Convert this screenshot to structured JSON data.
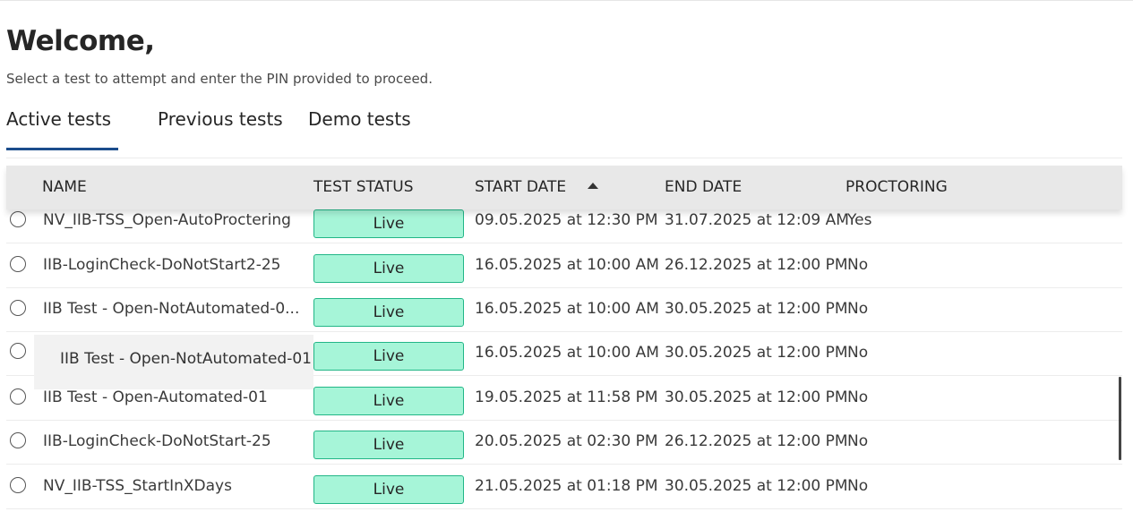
{
  "header": {
    "title": "Welcome,",
    "subtitle": "Select a test to attempt and enter the PIN provided to proceed."
  },
  "tabs": [
    {
      "label": "Active tests",
      "selected": true
    },
    {
      "label": "Previous tests",
      "selected": false
    },
    {
      "label": "Demo tests",
      "selected": false
    }
  ],
  "table": {
    "columns": {
      "name": "NAME",
      "status": "TEST STATUS",
      "start_date": "START DATE",
      "end_date": "END DATE",
      "proctoring": "PROCTORING"
    },
    "sort": {
      "column": "START DATE",
      "direction": "ascending"
    },
    "rows": [
      {
        "name": "NV_IIB-TSS_Open-AutoProctering",
        "status": "Live",
        "start_date": "09.05.2025 at 12:30 PM",
        "end_date": "31.07.2025 at 12:09 AM",
        "proctoring": "Yes"
      },
      {
        "name": "IIB-LoginCheck-DoNotStart2-25",
        "status": "Live",
        "start_date": "16.05.2025 at 10:00 AM",
        "end_date": "26.12.2025 at 12:00 PM",
        "proctoring": "No"
      },
      {
        "name": "IIB Test - Open-NotAutomated-0...",
        "status": "Live",
        "start_date": "16.05.2025 at 10:00 AM",
        "end_date": "30.05.2025 at 12:00 PM",
        "proctoring": "No"
      },
      {
        "name": "",
        "status": "Live",
        "start_date": "16.05.2025 at 10:00 AM",
        "end_date": "30.05.2025 at 12:00 PM",
        "proctoring": "No"
      },
      {
        "name": "IIB Test - Open-Automated-01",
        "status": "Live",
        "start_date": "19.05.2025 at 11:58 PM",
        "end_date": "30.05.2025 at 12:00 PM",
        "proctoring": "No"
      },
      {
        "name": "IIB-LoginCheck-DoNotStart-25",
        "status": "Live",
        "start_date": "20.05.2025 at 02:30 PM",
        "end_date": "26.12.2025 at 12:00 PM",
        "proctoring": "No"
      },
      {
        "name": "NV_IIB-TSS_StartInXDays",
        "status": "Live",
        "start_date": "21.05.2025 at 01:18 PM",
        "end_date": "30.05.2025 at 12:00 PM",
        "proctoring": "No"
      }
    ]
  },
  "tooltip": {
    "text": "IIB Test - Open-NotAutomated-01"
  },
  "colors": {
    "live_badge_bg": "#a6f5d8",
    "live_badge_border": "#22b687",
    "tab_underline": "#1b4d8c",
    "header_bg": "#e8e8e8"
  }
}
